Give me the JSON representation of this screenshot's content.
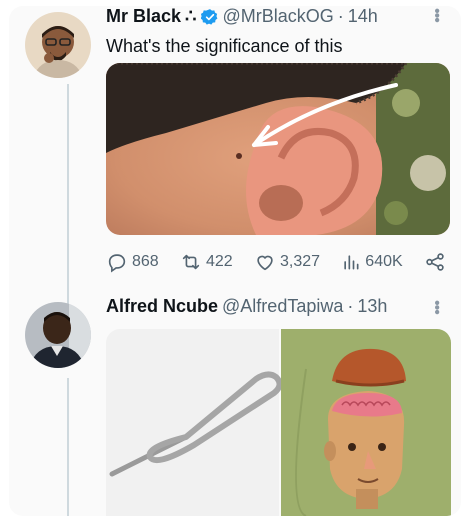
{
  "tweet1": {
    "name": "Mr Black",
    "name_suffix": "∴",
    "handle": "@MrBlackOG",
    "separator": "·",
    "time": "14h",
    "text": "What's the significance of this",
    "stats": {
      "replies": "868",
      "reposts": "422",
      "likes": "3,327",
      "views": "640K"
    }
  },
  "tweet2": {
    "name": "Alfred Ncube",
    "handle": "@AlfredTapiwa",
    "separator": "·",
    "time": "13h"
  },
  "icons": {
    "verified": "verified-badge-icon",
    "more": "more-vertical-icon",
    "reply": "reply-icon",
    "repost": "repost-icon",
    "like": "heart-icon",
    "views": "views-chart-icon",
    "share": "share-icon"
  },
  "colors": {
    "verified_blue": "#1d9bf0",
    "meta_gray": "#536471",
    "text": "#0f1419"
  }
}
